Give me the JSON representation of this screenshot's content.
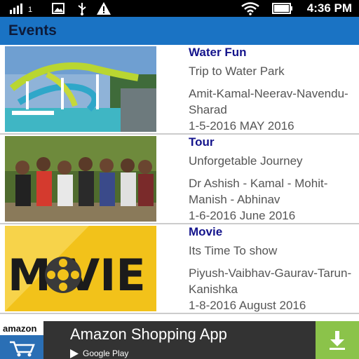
{
  "status_bar": {
    "time": "4:36 PM",
    "sim_indicator": "1",
    "icons": [
      "signal-icon",
      "image-icon",
      "usb-icon",
      "warning-icon",
      "wifi-icon",
      "battery-icon"
    ]
  },
  "app_bar": {
    "title": "Events"
  },
  "events": [
    {
      "title": "Water Fun",
      "subtitle": "Trip to Water Park",
      "people": "Amit-Kamal-Neerav-Navendu-Sharad",
      "date": "1-5-2016 MAY 2016",
      "image": "water-park-photo"
    },
    {
      "title": "Tour",
      "subtitle": "Unforgetable Journey",
      "people": "Dr Ashish - Kamal - Mohit-Manish - Abhinav",
      "date": "1-6-2016 June 2016",
      "image": "group-photo"
    },
    {
      "title": "Movie",
      "subtitle": "Its Time To show",
      "people": "Piyush-Vaibhav-Gaurav-Tarun-Kanishka",
      "date": "1-8-2016 August 2016",
      "image": "movie-poster",
      "poster_text": "M  VIE"
    }
  ],
  "ad": {
    "logo_text": "amazon",
    "title": "Amazon Shopping App",
    "store_label": "Google Play"
  },
  "colors": {
    "app_bar": "#1a73c4",
    "title_text": "#14148c",
    "ad_install": "#8bc34a"
  }
}
